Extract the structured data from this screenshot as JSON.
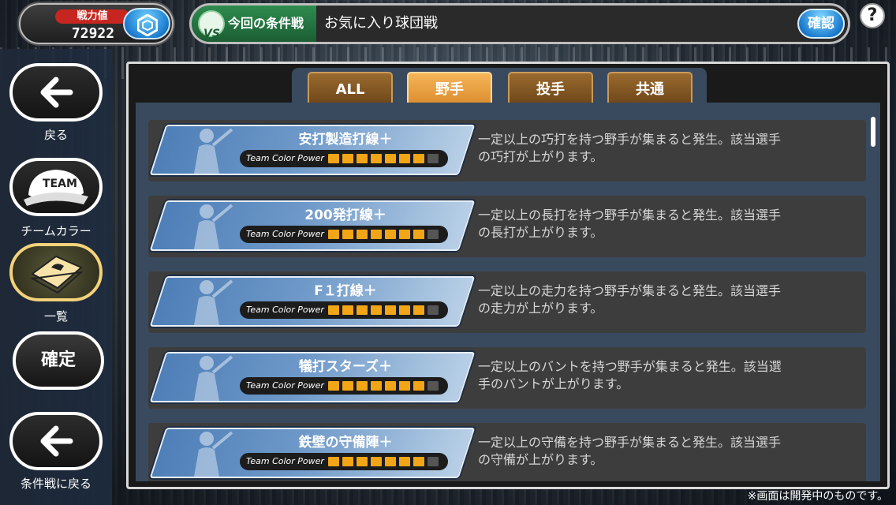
{
  "header": {
    "power_label": "戦力値",
    "power_value": "72922",
    "condition_tag": "今回の条件戦",
    "condition_name": "お気に入り球団戦",
    "confirm_label": "確認",
    "help_label": "?"
  },
  "leftnav": {
    "back_label": "戻る",
    "team_color_label": "チームカラー",
    "list_label": "一覧",
    "confirm_label": "確定",
    "return_label": "条件戦に戻る"
  },
  "tabs": [
    {
      "label": "ALL",
      "active": false
    },
    {
      "label": "野手",
      "active": true
    },
    {
      "label": "投手",
      "active": false
    },
    {
      "label": "共通",
      "active": false
    }
  ],
  "tcp_label": "Team Color Power",
  "rows": [
    {
      "title": "安打製造打線＋",
      "power": 7,
      "max": 8,
      "desc1": "一定以上の巧打を持つ野手が集まると発生。該当選手",
      "desc2": "の巧打が上がります。"
    },
    {
      "title": "200発打線＋",
      "power": 7,
      "max": 8,
      "desc1": "一定以上の長打を持つ野手が集まると発生。該当選手",
      "desc2": "の長打が上がります。"
    },
    {
      "title": "F１打線＋",
      "power": 7,
      "max": 8,
      "desc1": "一定以上の走力を持つ野手が集まると発生。該当選手",
      "desc2": "の走力が上がります。"
    },
    {
      "title": "犠打スターズ＋",
      "power": 7,
      "max": 8,
      "desc1": "一定以上のバントを持つ野手が集まると発生。該当選",
      "desc2": "手のバントが上がります。"
    },
    {
      "title": "鉄壁の守備陣＋",
      "power": 7,
      "max": 8,
      "desc1": "一定以上の守備を持つ野手が集まると発生。該当選手",
      "desc2": "の守備が上がります。"
    }
  ],
  "footnote": "※画面は開発中のものです。",
  "colors": {
    "accent": "#f2a516",
    "tab_active": "#e9a040",
    "card_blue": "#5b8bc2"
  }
}
